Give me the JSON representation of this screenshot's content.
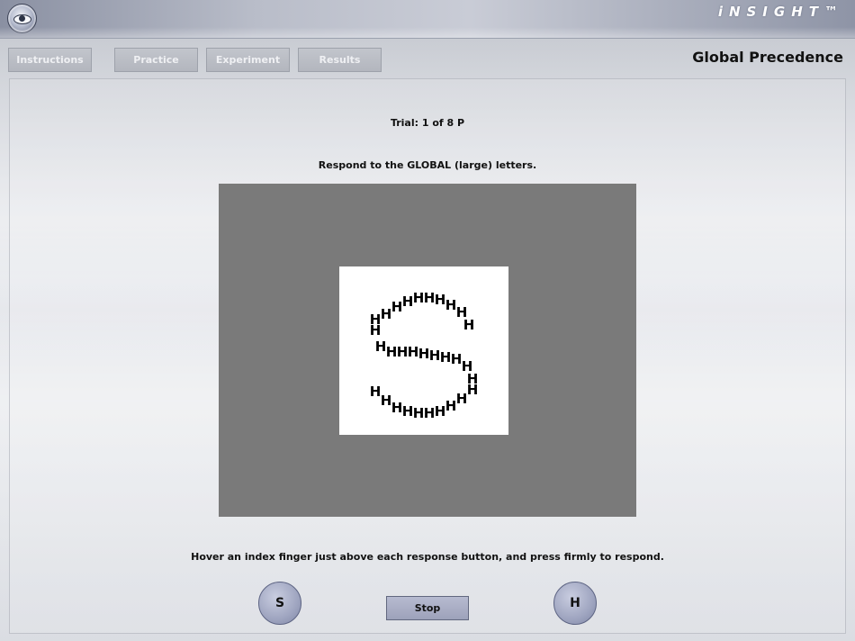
{
  "header": {
    "brand": "iNSIGHT™"
  },
  "nav": {
    "items": [
      {
        "label": "Instructions"
      },
      {
        "label": "Practice"
      },
      {
        "label": "Experiment"
      },
      {
        "label": "Results"
      }
    ]
  },
  "page": {
    "title": "Global Precedence",
    "trial": "Trial: 1 of 8 P",
    "instruction": "Respond to the GLOBAL (large) letters.",
    "hint": "Hover an index finger just above each response button, and press firmly to respond."
  },
  "stimulus": {
    "global_letter": "S",
    "local_letter": "H",
    "colors": {
      "field": "#7a7a7a",
      "card": "#ffffff",
      "letters": "#000000"
    }
  },
  "responses": {
    "left_label": "S",
    "right_label": "H",
    "stop_label": "Stop"
  }
}
